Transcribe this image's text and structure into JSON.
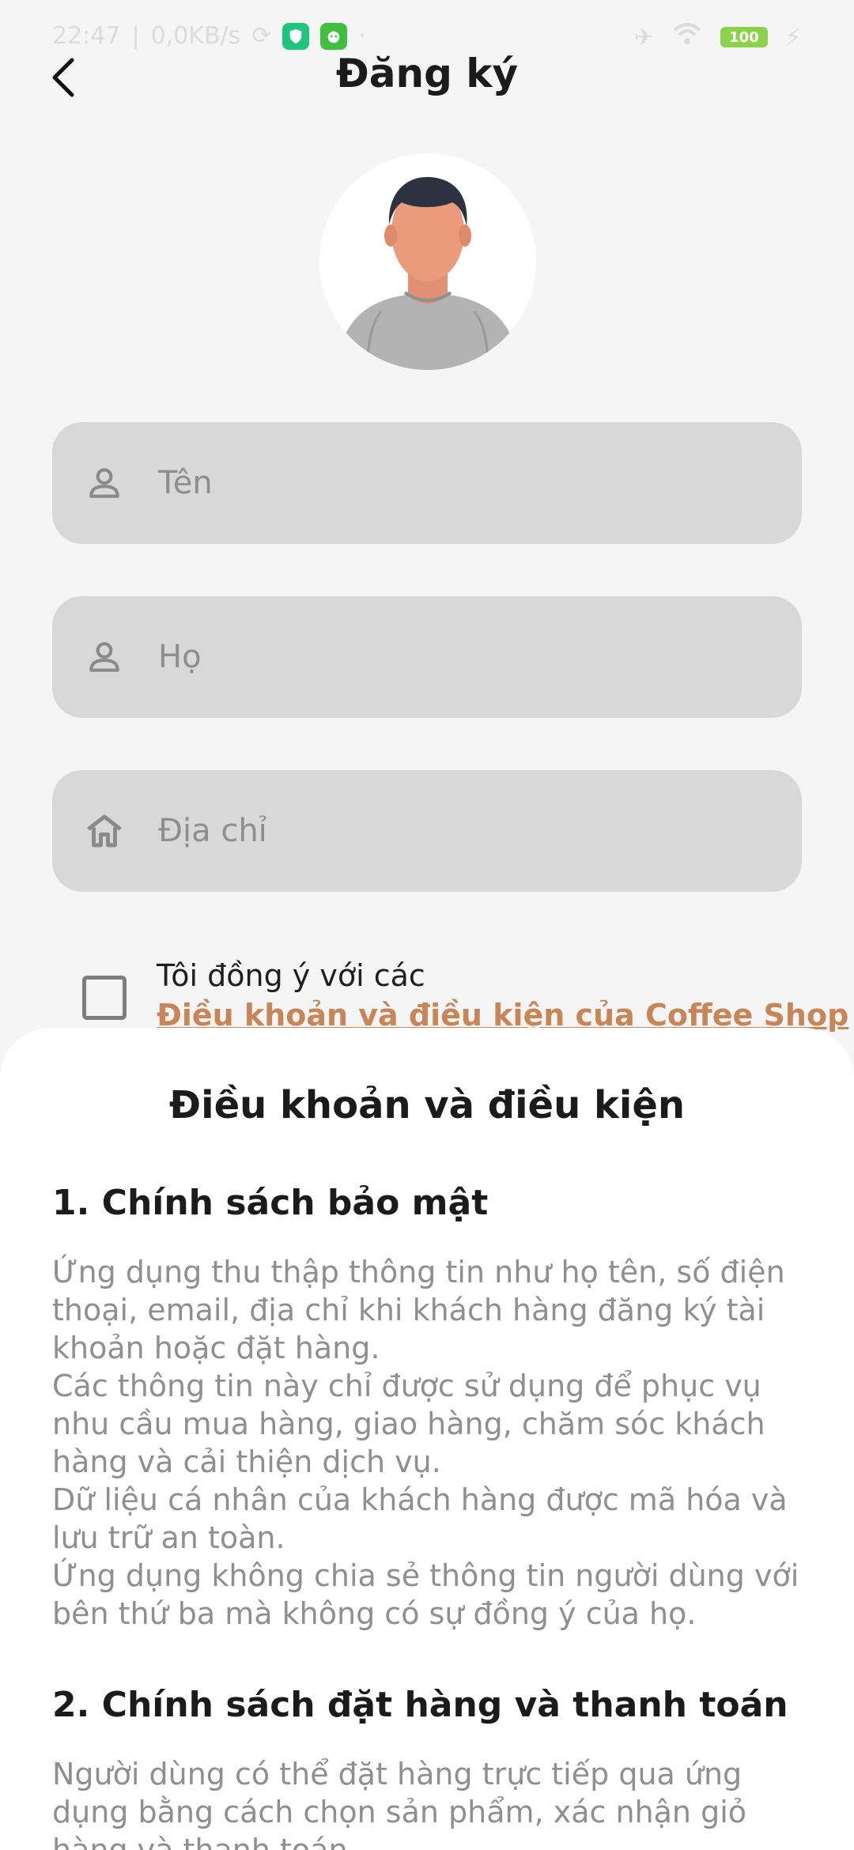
{
  "status_bar": {
    "time": "22:47",
    "network_speed": "0,0KB/s",
    "battery": "100",
    "colors": {
      "shield_badge": "#1fc57a",
      "cat_badge": "#3fbf3f",
      "battery": "#8ad34a"
    }
  },
  "header": {
    "title": "Đăng ký"
  },
  "form": {
    "first_name_placeholder": "Tên",
    "last_name_placeholder": "Họ",
    "address_placeholder": "Địa chỉ",
    "agree_text": "Tôi đồng ý với các",
    "terms_link": "Điều khoản và điều kiện của Coffee Shop"
  },
  "sheet": {
    "title": "Điều khoản và điều kiện",
    "sections": [
      {
        "heading": "1. Chính sách bảo mật",
        "paragraphs": [
          "Ứng dụng thu thập thông tin như họ tên, số điện thoại, email, địa chỉ khi khách hàng đăng ký tài khoản hoặc đặt hàng.",
          "Các thông tin này chỉ được sử dụng để phục vụ nhu cầu mua hàng, giao hàng, chăm sóc khách hàng và cải thiện dịch vụ.",
          "Dữ liệu cá nhân của khách hàng được mã hóa và lưu trữ an toàn.",
          "Ứng dụng không chia sẻ thông tin người dùng với bên thứ ba mà không có sự đồng ý của họ."
        ]
      },
      {
        "heading": "2. Chính sách đặt hàng và thanh toán",
        "paragraphs": [
          "Người dùng có thể đặt hàng trực tiếp qua ứng dụng bằng cách chọn sản phẩm, xác nhận giỏ hàng và thanh toán."
        ]
      }
    ]
  },
  "icons": {
    "back": "chevron-left-icon",
    "first_name": "person-icon",
    "last_name": "person-icon",
    "address": "home-icon"
  },
  "colors": {
    "accent": "#c88557",
    "field_background": "#d8d8d8",
    "page_background": "#f5f5f5"
  }
}
